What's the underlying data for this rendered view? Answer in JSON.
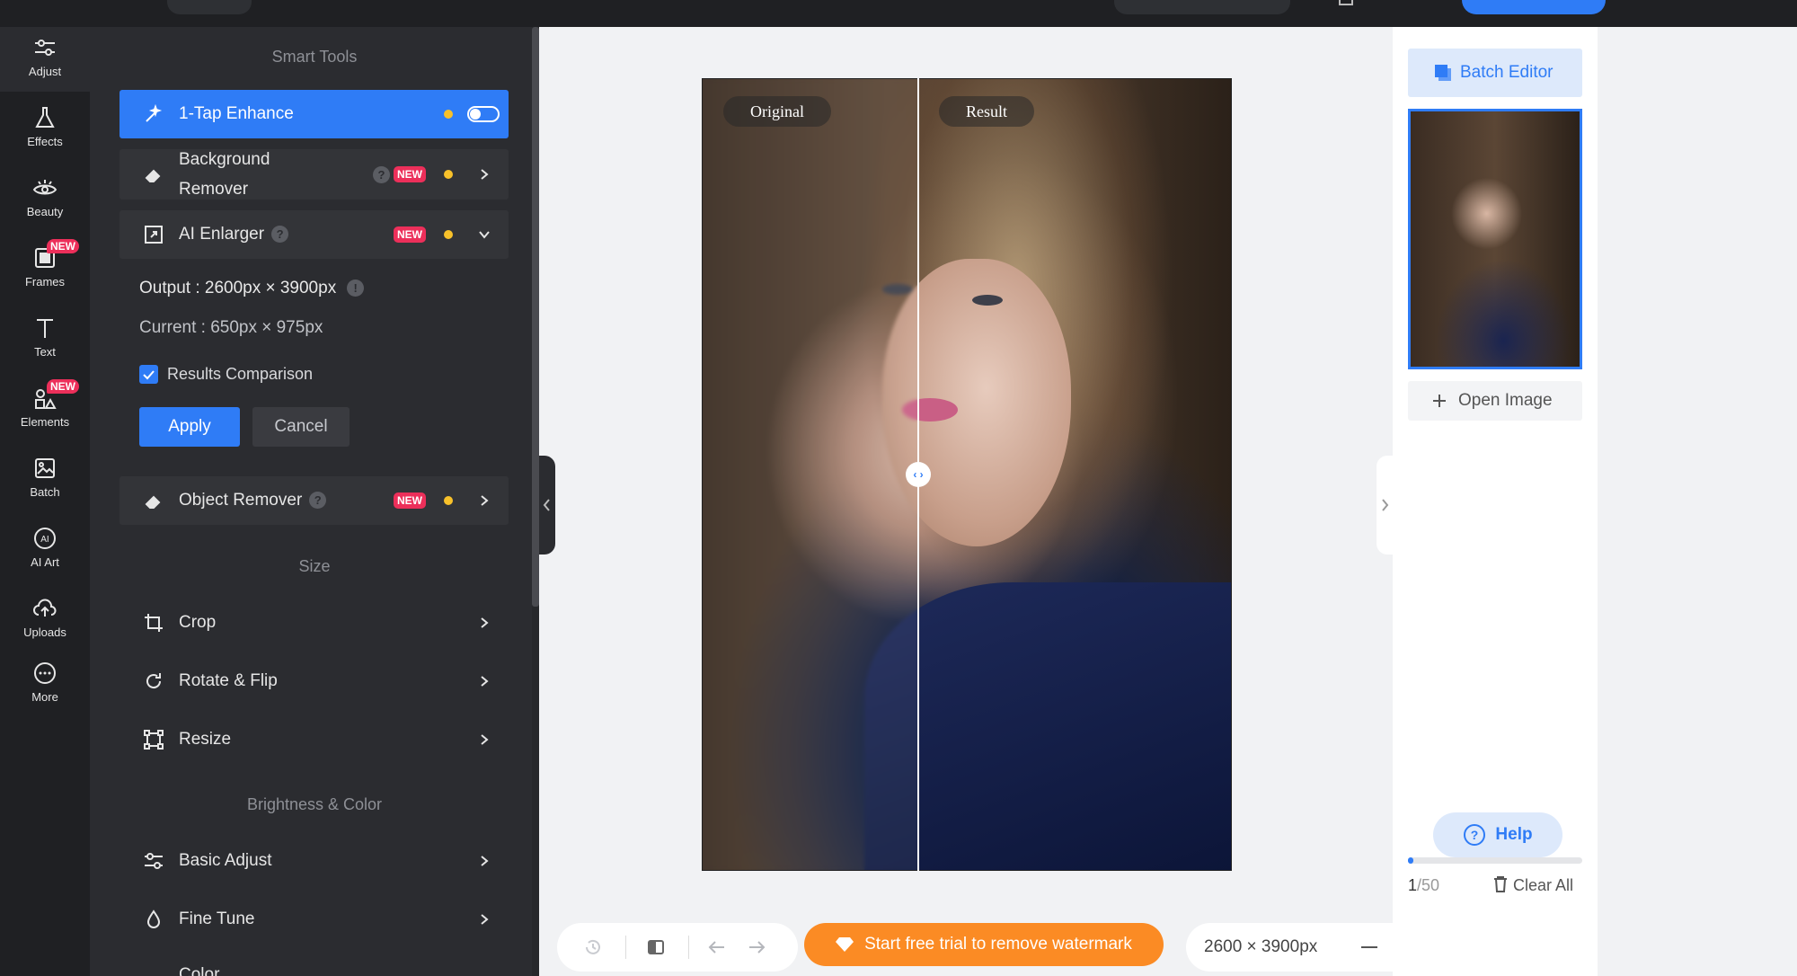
{
  "rail": {
    "items": [
      {
        "label": "Adjust",
        "icon": "sliders-icon"
      },
      {
        "label": "Effects",
        "icon": "flask-icon"
      },
      {
        "label": "Beauty",
        "icon": "eye-icon"
      },
      {
        "label": "Frames",
        "icon": "frame-icon",
        "badge": "NEW"
      },
      {
        "label": "Text",
        "icon": "text-icon"
      },
      {
        "label": "Elements",
        "icon": "shapes-icon",
        "badge": "NEW"
      },
      {
        "label": "Batch",
        "icon": "images-icon"
      },
      {
        "label": "AI Art",
        "icon": "ai-icon"
      },
      {
        "label": "Uploads",
        "icon": "cloud-upload-icon"
      },
      {
        "label": "More",
        "icon": "more-icon"
      }
    ]
  },
  "panel": {
    "smart_tools_title": "Smart Tools",
    "enhance": {
      "label": "1-Tap Enhance"
    },
    "bg_remover": {
      "label_line1": "Background",
      "label_line2": "Remover",
      "badge": "NEW"
    },
    "ai_enlarger": {
      "label": "AI Enlarger",
      "badge": "NEW"
    },
    "output_text": "Output : 2600px × 3900px",
    "current_text": "Current : 650px × 975px",
    "results_comparison_label": "Results Comparison",
    "apply_label": "Apply",
    "cancel_label": "Cancel",
    "object_remover": {
      "label": "Object Remover",
      "badge": "NEW"
    },
    "size_title": "Size",
    "crop_label": "Crop",
    "rotate_label": "Rotate & Flip",
    "resize_label": "Resize",
    "brightness_title": "Brightness & Color",
    "basic_adjust_label": "Basic Adjust",
    "fine_tune_label": "Fine Tune",
    "color_label": "Color"
  },
  "canvas": {
    "tag_original": "Original",
    "tag_result": "Result",
    "promo_label": "Start free trial to remove watermark",
    "dimensions_label": "2600 × 3900px"
  },
  "right_panel": {
    "batch_editor_label": "Batch Editor",
    "open_image_label": "Open Image",
    "help_label": "Help",
    "count_current": "1",
    "count_total": "/50",
    "clear_all_label": "Clear All",
    "progress": 0.02
  },
  "colors": {
    "accent": "#2f7cf6",
    "badge": "#ec2f5a",
    "promo": "#fb8b24",
    "dot": "#f8c12a"
  }
}
